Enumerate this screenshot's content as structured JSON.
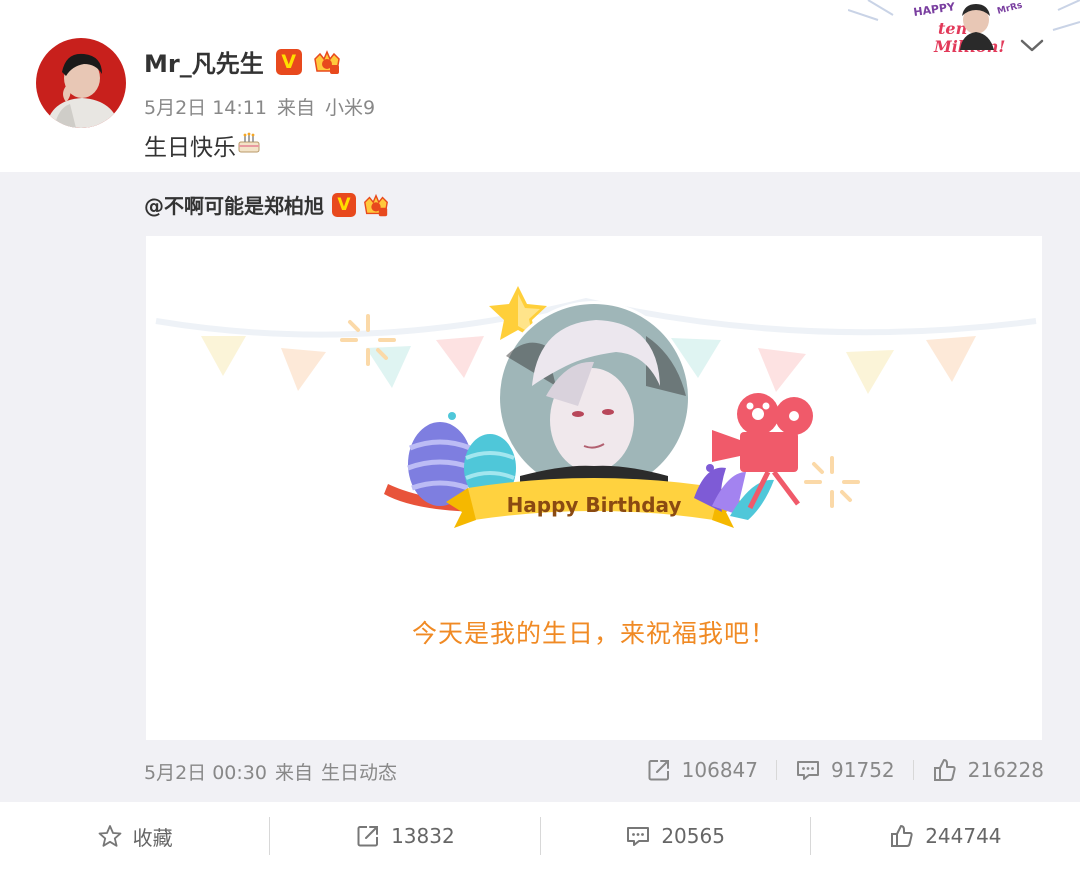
{
  "post": {
    "author": "Mr_凡先生",
    "verified_badge": "V",
    "date": "5月2日 14:11",
    "source_prefix": "来自",
    "source": "小米9",
    "text": "生日快乐",
    "emoji": "cake-emoji",
    "corner_badge": {
      "line1": "HAPPY",
      "line2": "ten",
      "line3": "Million!",
      "tag": "MrRs"
    }
  },
  "repost": {
    "author": "@不啊可能是郑柏旭",
    "verified_badge": "V",
    "card": {
      "banner_text": "Happy Birthday",
      "message": "今天是我的生日，来祝福我吧！"
    },
    "date": "5月2日 00:30",
    "source_prefix": "来自",
    "source": "生日动态",
    "stats": {
      "reposts": "106847",
      "comments": "91752",
      "likes": "216228"
    }
  },
  "actions": {
    "favorite_label": "收藏",
    "reposts": "13832",
    "comments": "20565",
    "likes": "244744"
  },
  "colors": {
    "accent_orange": "#f08a24",
    "verified_red": "#e8491d",
    "verified_yellow": "#ffde00",
    "repost_bg": "#f1f1f5",
    "meta_gray": "#888888"
  }
}
